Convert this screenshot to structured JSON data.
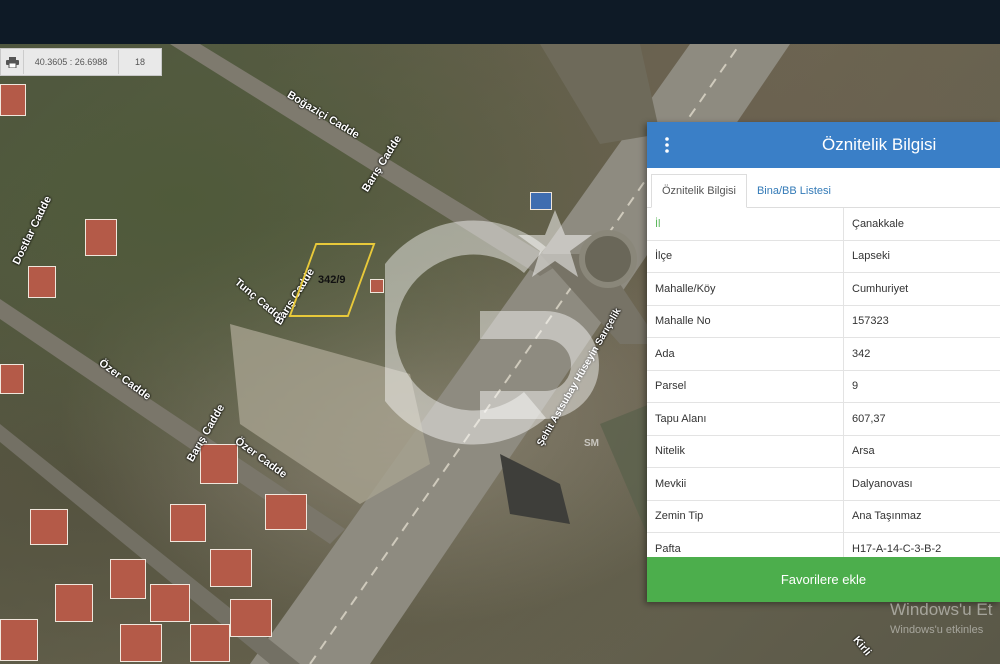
{
  "toolbar": {
    "print_icon": "printer-icon",
    "coordinates": "40.3605 : 26.6988",
    "zoom_level": "18"
  },
  "map": {
    "streets": [
      {
        "name": "Boğaziçi Cadde"
      },
      {
        "name": "Barış Cadde"
      },
      {
        "name": "Dostlar Cadde"
      },
      {
        "name": "Tunç Cadde"
      },
      {
        "name": "Barış Cadde"
      },
      {
        "name": "Özer Cadde"
      },
      {
        "name": "Barış Cadde"
      },
      {
        "name": "Özer Cadde"
      },
      {
        "name": "Şehit Astsubay Hüseyin Sarıçelik"
      },
      {
        "name": "Kirli"
      }
    ],
    "parcel_label": "342/9",
    "watermark_mark": "SM"
  },
  "panel": {
    "title": "Öznitelik Bilgisi",
    "menu_icon": "vertical-dots-icon",
    "header_color": "#3a7fc7",
    "tabs": [
      {
        "label": "Öznitelik Bilgisi",
        "active": true
      },
      {
        "label": "Bina/BB Listesi",
        "active": false
      }
    ],
    "rows": [
      {
        "key": "İl",
        "value": "Çanakkale"
      },
      {
        "key": "İlçe",
        "value": "Lapseki"
      },
      {
        "key": "Mahalle/Köy",
        "value": "Cumhuriyet"
      },
      {
        "key": "Mahalle No",
        "value": "157323"
      },
      {
        "key": "Ada",
        "value": "342"
      },
      {
        "key": "Parsel",
        "value": "9"
      },
      {
        "key": "Tapu Alanı",
        "value": "607,37"
      },
      {
        "key": "Nitelik",
        "value": "Arsa"
      },
      {
        "key": "Mevkii",
        "value": "Dalyanovası"
      },
      {
        "key": "Zemin Tip",
        "value": "Ana Taşınmaz"
      },
      {
        "key": "Pafta",
        "value": "H17-A-14-C-3-B-2"
      }
    ],
    "favorite_button": "Favorilere ekle",
    "favorite_color": "#4cae4c"
  },
  "os_overlay": {
    "title": "Windows'u Et",
    "subtitle": "Windows'u etkinles"
  }
}
